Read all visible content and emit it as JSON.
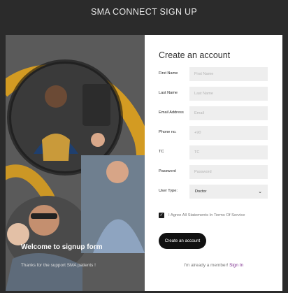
{
  "page": {
    "title": "SMA CONNECT SIGN UP"
  },
  "hero": {
    "title": "Welcome to signup form",
    "subtitle": "Thanks for the support SMA patients !"
  },
  "form": {
    "heading": "Create an account",
    "fields": [
      {
        "label": "First Name",
        "placeholder": "First Name"
      },
      {
        "label": "Last Name",
        "placeholder": "Last Name"
      },
      {
        "label": "Email Address",
        "placeholder": "Email"
      },
      {
        "label": "Phone no.",
        "placeholder": "+90"
      },
      {
        "label": "TC",
        "placeholder": "TC"
      },
      {
        "label": "Password",
        "placeholder": "Password"
      }
    ],
    "user_type": {
      "label": "User Type:",
      "value": "Doctor"
    },
    "terms": {
      "label": "I Agree All Statements In Terms Of Service",
      "checked": true
    },
    "submit_label": "Create an account",
    "member_text": "I'm already a member!",
    "signin_label": "Sign In"
  },
  "colors": {
    "accent": "#e0a21c",
    "link": "#7a2a8c",
    "button": "#111111"
  }
}
